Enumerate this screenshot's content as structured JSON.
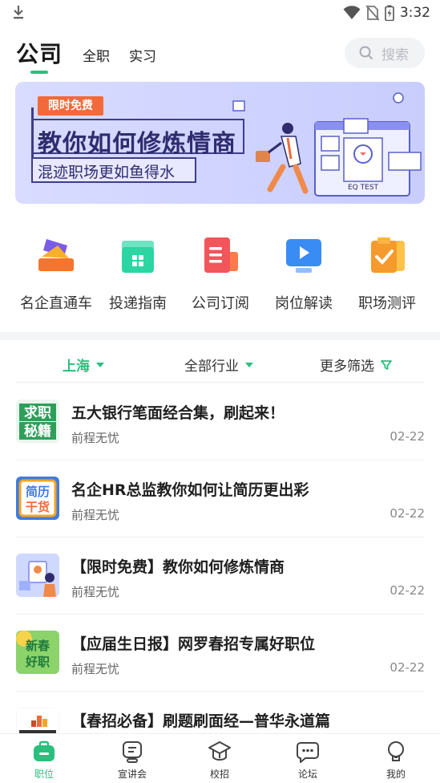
{
  "status_bar": {
    "time": "3:32",
    "icons": [
      "download-icon",
      "wifi-icon",
      "no-sim-icon",
      "battery-icon"
    ]
  },
  "header": {
    "main_tab": "公司",
    "sub_tabs": [
      "全职",
      "实习"
    ],
    "search_placeholder": "搜索"
  },
  "banner": {
    "badge": "限时免费",
    "title": "教你如何修炼情商",
    "subtitle": "混迹职场更如鱼得水",
    "art_text": "EQ TEST"
  },
  "quick_links": [
    {
      "label": "名企直通车",
      "icon": "ticket-icon"
    },
    {
      "label": "投递指南",
      "icon": "shopping-bag-icon"
    },
    {
      "label": "公司订阅",
      "icon": "document-list-icon"
    },
    {
      "label": "岗位解读",
      "icon": "video-play-icon"
    },
    {
      "label": "职场测评",
      "icon": "clipboard-check-icon"
    }
  ],
  "filters": {
    "city": "上海",
    "industry": "全部行业",
    "more": "更多筛选"
  },
  "articles": [
    {
      "title": "五大银行笔面经合集，刷起来！",
      "source": "前程无忧",
      "date": "02-22",
      "thumb_text": [
        "求职",
        "秘籍"
      ]
    },
    {
      "title": "名企HR总监教你如何让简历更出彩",
      "source": "前程无忧",
      "date": "02-22",
      "thumb_text": [
        "简历",
        "干货"
      ]
    },
    {
      "title": "【限时免费】教你如何修炼情商",
      "source": "前程无忧",
      "date": "02-22",
      "thumb_text": []
    },
    {
      "title": "【应届生日报】网罗春招专属好职位",
      "source": "前程无忧",
      "date": "02-22",
      "thumb_text": [
        "新春",
        "好职"
      ]
    },
    {
      "title": "【春招必备】刷题刷面经—普华永道篇",
      "source": "",
      "date": "",
      "thumb_text": []
    }
  ],
  "bottom_nav": [
    {
      "label": "职位",
      "icon": "briefcase-icon",
      "active": true
    },
    {
      "label": "宣讲会",
      "icon": "presentation-icon",
      "active": false
    },
    {
      "label": "校招",
      "icon": "graduation-cap-icon",
      "active": false
    },
    {
      "label": "论坛",
      "icon": "chat-bubble-icon",
      "active": false
    },
    {
      "label": "我的",
      "icon": "profile-icon",
      "active": false
    }
  ],
  "colors": {
    "accent": "#2bbf7e",
    "banner_bg": "#d9dcff",
    "badge": "#f26a3a",
    "banner_text": "#2f2c6e"
  }
}
